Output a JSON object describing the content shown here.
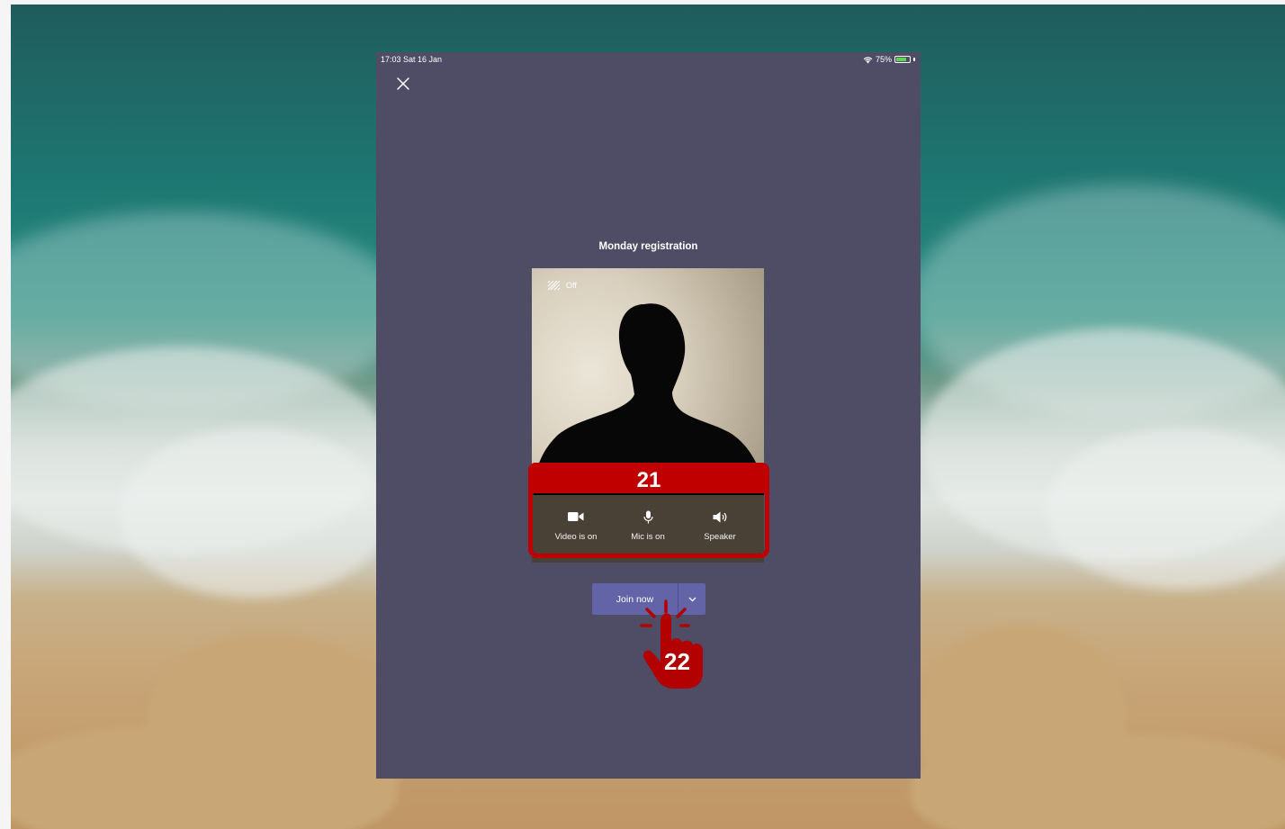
{
  "status_bar": {
    "time": "17:03  Sat 16 Jan",
    "battery": "75%",
    "battery_level": 0.75
  },
  "meeting": {
    "title": "Monday registration"
  },
  "preview": {
    "background_effects_label": "Off"
  },
  "controls": [
    {
      "label": "Video is on",
      "icon": "video-camera-icon"
    },
    {
      "label": "Mic is on",
      "icon": "microphone-icon"
    },
    {
      "label": "Speaker",
      "icon": "speaker-icon"
    }
  ],
  "join": {
    "label": "Join now",
    "dropdown_icon": "chevron-down-icon"
  },
  "annotations": {
    "step_controls": "21",
    "step_join": "22"
  },
  "colors": {
    "app_background": "#4f4d65",
    "join_button": "#6264a7",
    "annotation": "#c00000",
    "battery": "#5fd35a"
  }
}
